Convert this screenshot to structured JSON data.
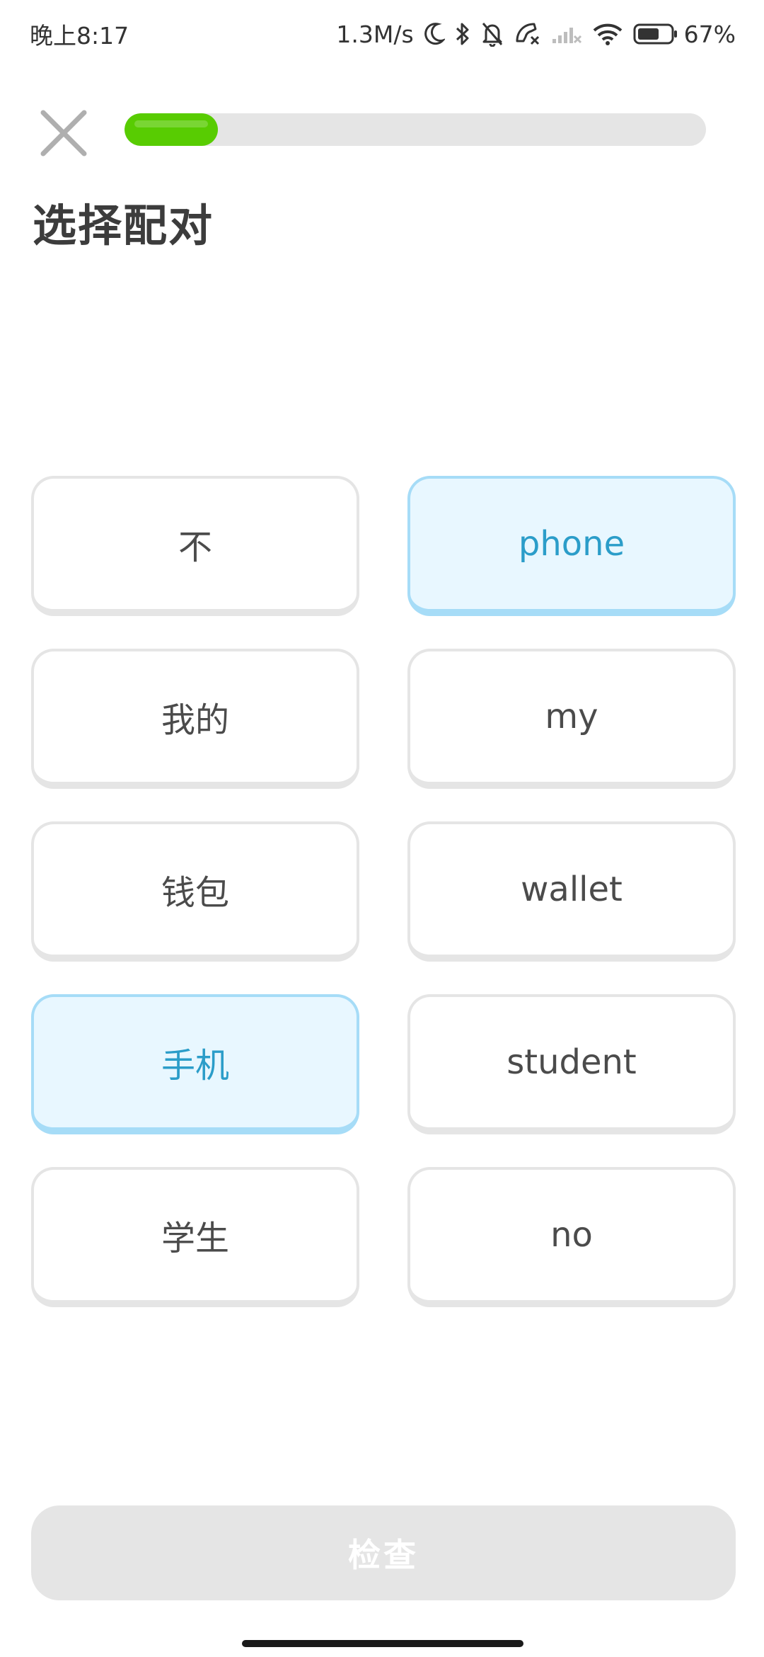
{
  "status_bar": {
    "time": "晚上8:17",
    "network_speed": "1.3M/s",
    "battery_percent": "67%",
    "battery_level": 0.67,
    "icons": [
      "moon-icon",
      "bluetooth-icon",
      "mute-bell-icon",
      "missed-call-icon",
      "cell-signal-icon",
      "wifi-icon",
      "battery-icon"
    ]
  },
  "header": {
    "close_icon": "close-icon",
    "progress_fraction": 0.16
  },
  "page": {
    "title": "选择配对"
  },
  "tiles": {
    "left": [
      {
        "label": "不",
        "selected": false
      },
      {
        "label": "我的",
        "selected": false
      },
      {
        "label": "钱包",
        "selected": false
      },
      {
        "label": "手机",
        "selected": true
      },
      {
        "label": "学生",
        "selected": false
      }
    ],
    "right": [
      {
        "label": "phone",
        "selected": true
      },
      {
        "label": "my",
        "selected": false
      },
      {
        "label": "wallet",
        "selected": false
      },
      {
        "label": "student",
        "selected": false
      },
      {
        "label": "no",
        "selected": false
      }
    ]
  },
  "footer": {
    "check_label": "检查"
  },
  "colors": {
    "progress": "#58cc02",
    "selected_bg": "#e8f7ff",
    "selected_border": "#a6dcf7",
    "selected_text": "#2b9dc9",
    "disabled_button": "#e5e5e5"
  }
}
